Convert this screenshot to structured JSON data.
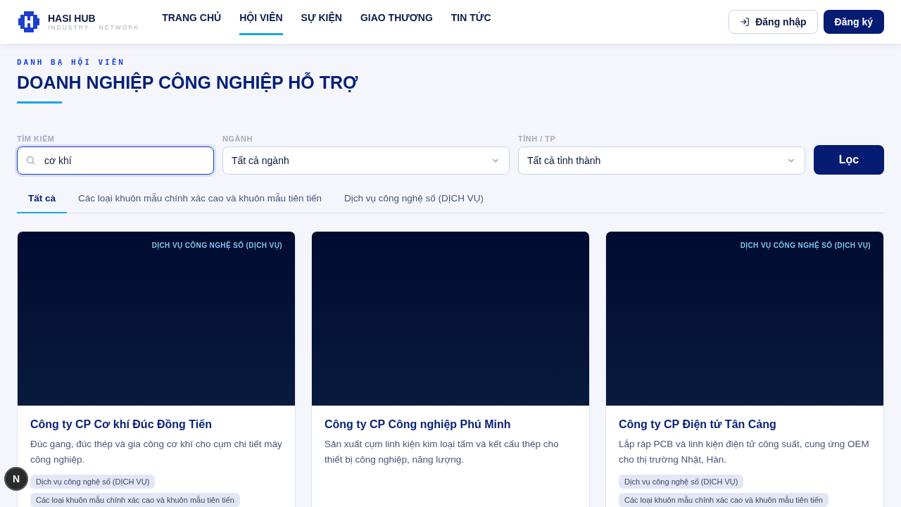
{
  "header": {
    "brand": {
      "name": "HASI HUB",
      "tagline": "INDUSTRY · NETWORK"
    },
    "nav": [
      {
        "label": "TRANG CHỦ",
        "selected": false
      },
      {
        "label": "HỘI VIÊN",
        "selected": true
      },
      {
        "label": "SỰ KIỆN",
        "selected": false
      },
      {
        "label": "GIAO THƯƠNG",
        "selected": false
      },
      {
        "label": "TIN TỨC",
        "selected": false
      }
    ],
    "login": "Đăng nhập",
    "register": "Đăng ký"
  },
  "page": {
    "eyebrow": "DANH BẠ HỘI VIÊN",
    "title": "DOANH NGHIỆP CÔNG NGHIỆP HỖ TRỢ"
  },
  "filters": {
    "search": {
      "label": "TÌM KIẾM",
      "value": "cơ khí"
    },
    "industry": {
      "label": "NGÀNH",
      "value": "Tất cả ngành"
    },
    "province": {
      "label": "TỈNH / TP",
      "value": "Tất cả tỉnh thành"
    },
    "submit": "Lọc"
  },
  "tabs": [
    {
      "label": "Tất cả",
      "selected": true
    },
    {
      "label": "Các loại khuôn mẫu chính xác cao và khuôn mẫu tiên tiến",
      "selected": false
    },
    {
      "label": "Dịch vụ công nghệ số (DỊCH VỤ)",
      "selected": false
    }
  ],
  "cards": [
    {
      "badge": "DỊCH VỤ CÔNG NGHỆ SỐ (DỊCH VỤ)",
      "name": "Công ty CP Cơ khí Đúc Đồng Tiến",
      "description": "Đúc gang, đúc thép và gia công cơ khí cho cụm chi tiết máy công nghiệp.",
      "tags": [
        "Dịch vụ công nghệ số (DỊCH VỤ)",
        "Các loại khuôn mẫu chính xác cao và khuôn mẫu tiên tiến"
      ]
    },
    {
      "name": "Công ty CP Công nghiệp Phú Minh",
      "description": "Sản xuất cụm linh kiện kim loại tấm và kết cấu thép cho thiết bị công nghiệp, năng lượng."
    },
    {
      "badge": "DỊCH VỤ CÔNG NGHỆ SỐ (DỊCH VỤ)",
      "name": "Công ty CP Điện tử Tân Cảng",
      "description": "Lắp ráp PCB và linh kiện điện tử công suất, cung ứng OEM cho thị trường Nhật, Hàn.",
      "tags": [
        "Dịch vụ công nghệ số (DỊCH VỤ)",
        "Các loại khuôn mẫu chính xác cao và khuôn mẫu tiên tiến"
      ]
    }
  ],
  "dev_badge": "N"
}
